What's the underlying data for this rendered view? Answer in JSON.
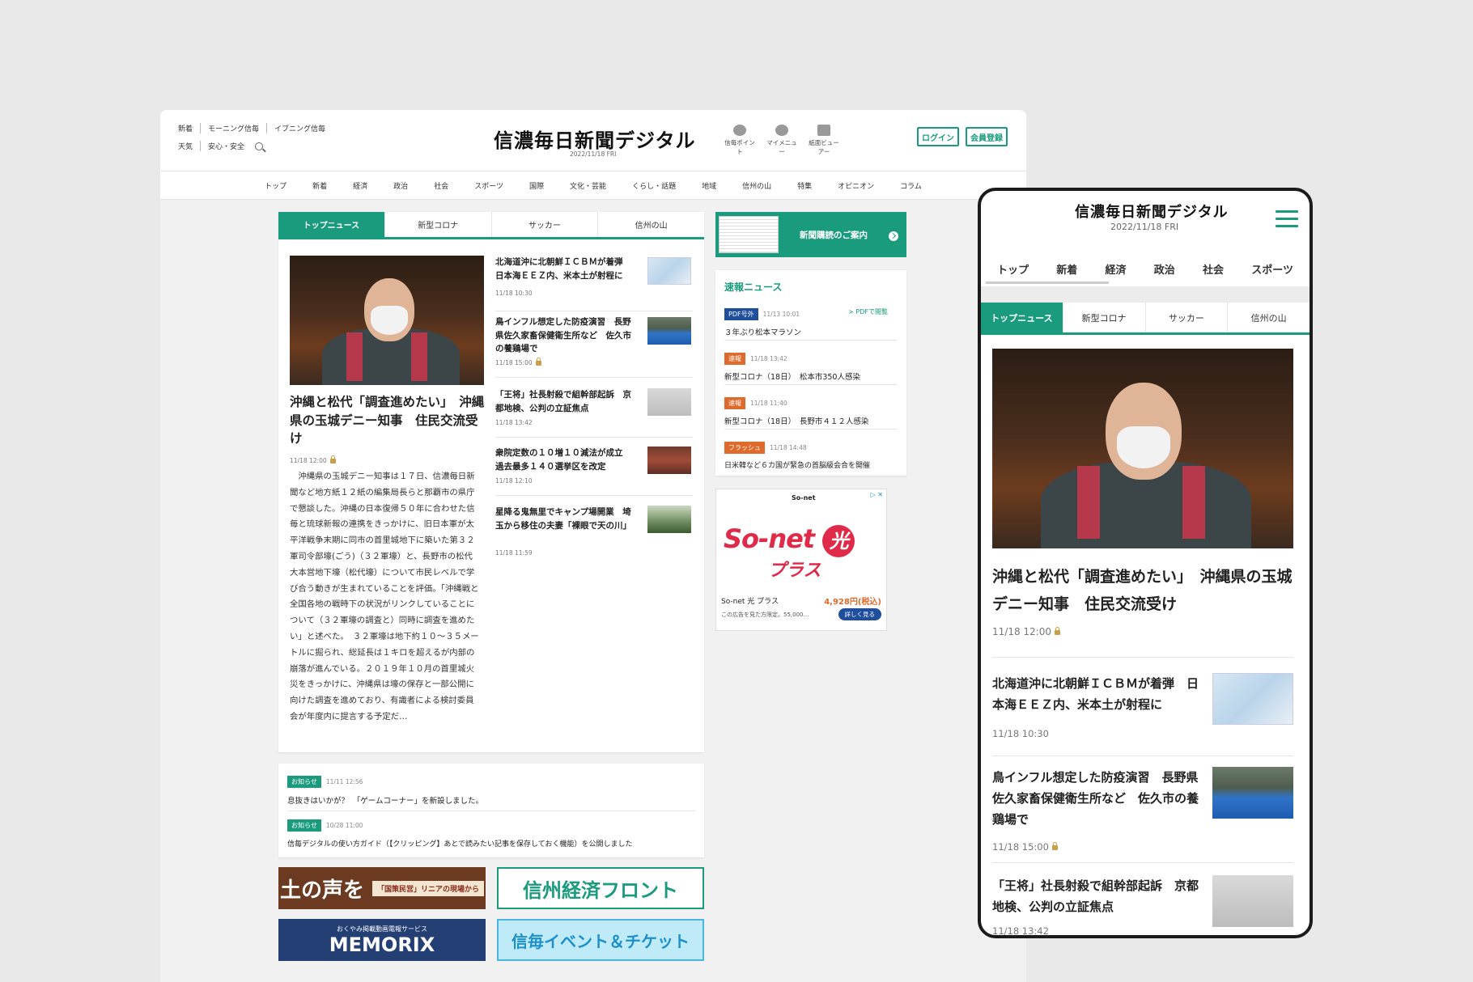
{
  "desktop": {
    "util_row1": [
      "新着",
      "モーニング信毎",
      "イブニング信毎"
    ],
    "util_row2": [
      "天気",
      "安心・安全"
    ],
    "logo": "信濃毎日新聞デジタル",
    "date": "2022/11/18 FRI",
    "header_icons": [
      "信毎ポイント",
      "マイメニュー",
      "紙面ビューアー"
    ],
    "login": "ログイン",
    "register": "会員登録",
    "nav": [
      "トップ",
      "新着",
      "経済",
      "政治",
      "社会",
      "スポーツ",
      "国際",
      "文化・芸能",
      "くらし・話題",
      "地域",
      "信州の山",
      "特集",
      "オピニオン",
      "コラム"
    ],
    "tabs": [
      "トップニュース",
      "新型コロナ",
      "サッカー",
      "信州の山"
    ],
    "lead": {
      "title": "沖縄と松代「調査進めたい」　沖縄県の玉城デニー知事　住民交流受け",
      "time": "11/18 12:00",
      "body": "沖縄県の玉城デニー知事は１７日、信濃毎日新聞など地方紙１２紙の編集局長らと那覇市の県庁で懇談した。沖縄の日本復帰５０年に合わせた信毎と琉球新報の連携をきっかけに、旧日本軍が太平洋戦争末期に同市の首里城地下に築いた第３２軍司令部壕(ごう)（３２軍壕）と、長野市の松代大本営地下壕（松代壕）について市民レベルで学び合う動きが生まれていることを評価。「沖縄戦と全国各地の戦時下の状況がリンクしていることについて（３２軍壕の調査と）同時に調査を進めたい」と述べた。　３２軍壕は地下約１０～３５メートルに掘られ、総延長は１キロを超えるが内部の崩落が進んでいる。２０１９年１０月の首里城火災をきっかけに、沖縄県は壕の保存と一部公開に向けた調査を進めており、有識者による検討委員会が年度内に提言する予定だ…"
    },
    "news": [
      {
        "title": "北海道沖に北朝鮮ＩＣＢＭが着弾　日本海ＥＥＺ内、米本土が射程に",
        "time": "11/18 10:30",
        "lock": false
      },
      {
        "title": "鳥インフル想定した防疫演習　長野県佐久家畜保健衛生所など　佐久市の養鶏場で",
        "time": "11/18 15:00",
        "lock": true
      },
      {
        "title": "「王将」社長射殺で組幹部起訴　京都地検、公判の立証焦点",
        "time": "11/18 13:42",
        "lock": false
      },
      {
        "title": "衆院定数の１０増１０減法が成立　過去最多１４０選挙区を改定",
        "time": "11/18 12:10",
        "lock": false
      },
      {
        "title": "星降る鬼無里でキャンプ場開業　埼玉から移住の夫妻「裸眼で天の川」",
        "time": "11/18 11:59",
        "lock": false
      }
    ],
    "subscribe": "新聞購読のご案内",
    "sokuho": {
      "title": "速報ニュース",
      "pdf_link": "> PDFで閲覧",
      "items": [
        {
          "badge": "PDF号外",
          "color": "blue",
          "time": "11/13 10:01",
          "text": "３年ぶり松本マラソン"
        },
        {
          "badge": "速報",
          "color": "orange",
          "time": "11/18 13:42",
          "text": "新型コロナ（18日）　松本市350人感染"
        },
        {
          "badge": "速報",
          "color": "orange",
          "time": "11/18 11:40",
          "text": "新型コロナ（18日）　長野市４１２人感染"
        },
        {
          "badge": "フラッシュ",
          "color": "orange",
          "time": "11/18 14:48",
          "text": "日米韓など６カ国が緊急の首脳級会合を開催"
        }
      ]
    },
    "ad": {
      "brand": "So-net",
      "headline": "So-net",
      "hikari": "光",
      "plus": "プラス",
      "name": "So-net 光 プラス",
      "price": "4,928円(税込)",
      "small": "この広告を見た方限定。55,000…",
      "detail": "詳しく見る",
      "x": "▷ ✕"
    },
    "notices": [
      {
        "badge": "お知らせ",
        "time": "11/11 12:56",
        "text": "息抜きはいかが？　「ゲームコーナー」を新設しました。"
      },
      {
        "badge": "お知らせ",
        "time": "10/28 11:00",
        "text": "信毎デジタルの使い方ガイド（【クリッピング】あとで読みたい記事を保存しておく機能）を公開しました"
      }
    ],
    "banners": [
      {
        "text": "土の声を",
        "sub": "「国策民営」リニアの現場から"
      },
      {
        "text": "信州経済フロント"
      },
      {
        "text": "MEMORIX",
        "sub": "おくやみ掲載動画電報サービス"
      },
      {
        "text": "信毎イベント＆チケット"
      }
    ]
  },
  "mobile": {
    "logo": "信濃毎日新聞デジタル",
    "date": "2022/11/18 FRI",
    "nav": [
      "トップ",
      "新着",
      "経済",
      "政治",
      "社会",
      "スポーツ"
    ],
    "tabs": [
      "トップニュース",
      "新型コロナ",
      "サッカー",
      "信州の山"
    ],
    "lead_title": "沖縄と松代「調査進めたい」　沖縄県の玉城デニー知事　住民交流受け",
    "lead_time": "11/18 12:00",
    "news": [
      {
        "title": "北海道沖に北朝鮮ＩＣＢＭが着弾　日本海ＥＥＺ内、米本土が射程に",
        "time": "11/18 10:30"
      },
      {
        "title": "鳥インフル想定した防疫演習　長野県佐久家畜保健衛生所など　佐久市の養鶏場で",
        "time": "11/18 15:00"
      },
      {
        "title": "「王将」社長射殺で組幹部起訴　京都地検、公判の立証焦点",
        "time": "11/18 13:42"
      }
    ]
  }
}
